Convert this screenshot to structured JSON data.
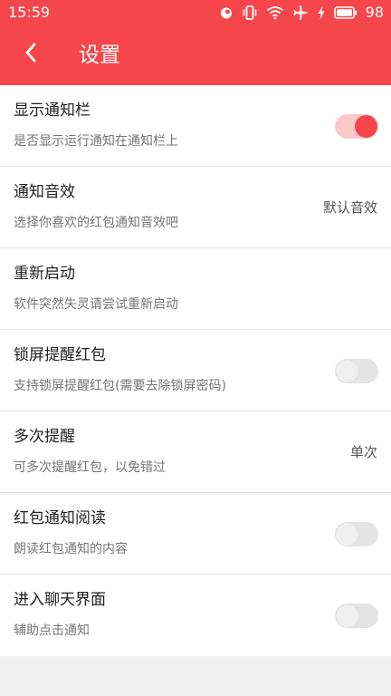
{
  "status_bar": {
    "time": "15:59",
    "battery_percent": "98",
    "icons": [
      "notification-icon",
      "vibrate-icon",
      "wifi-icon",
      "airplane-icon",
      "charging-icon",
      "battery-icon"
    ]
  },
  "toolbar": {
    "back_icon": "chevron-left-icon",
    "title": "设置"
  },
  "colors": {
    "accent": "#f5474b",
    "switch_on_track": "#f9c9cb",
    "switch_off_track": "#e4e4e4"
  },
  "settings": [
    {
      "title": "显示通知栏",
      "subtitle": "是否显示运行通知在通知栏上",
      "control": "switch",
      "on": true
    },
    {
      "title": "通知音效",
      "subtitle": "选择你喜欢的红包通知音效吧",
      "control": "value",
      "value": "默认音效"
    },
    {
      "title": "重新启动",
      "subtitle": "软件突然失灵请尝试重新启动",
      "control": "none"
    },
    {
      "title": "锁屏提醒红包",
      "subtitle": "支持锁屏提醒红包(需要去除锁屏密码)",
      "control": "switch",
      "on": false
    },
    {
      "title": "多次提醒",
      "subtitle": "可多次提醒红包，以免错过",
      "control": "value",
      "value": "单次"
    },
    {
      "title": "红包通知阅读",
      "subtitle": "朗读红包通知的内容",
      "control": "switch",
      "on": false
    },
    {
      "title": "进入聊天界面",
      "subtitle": "辅助点击通知",
      "control": "switch",
      "on": false
    }
  ]
}
